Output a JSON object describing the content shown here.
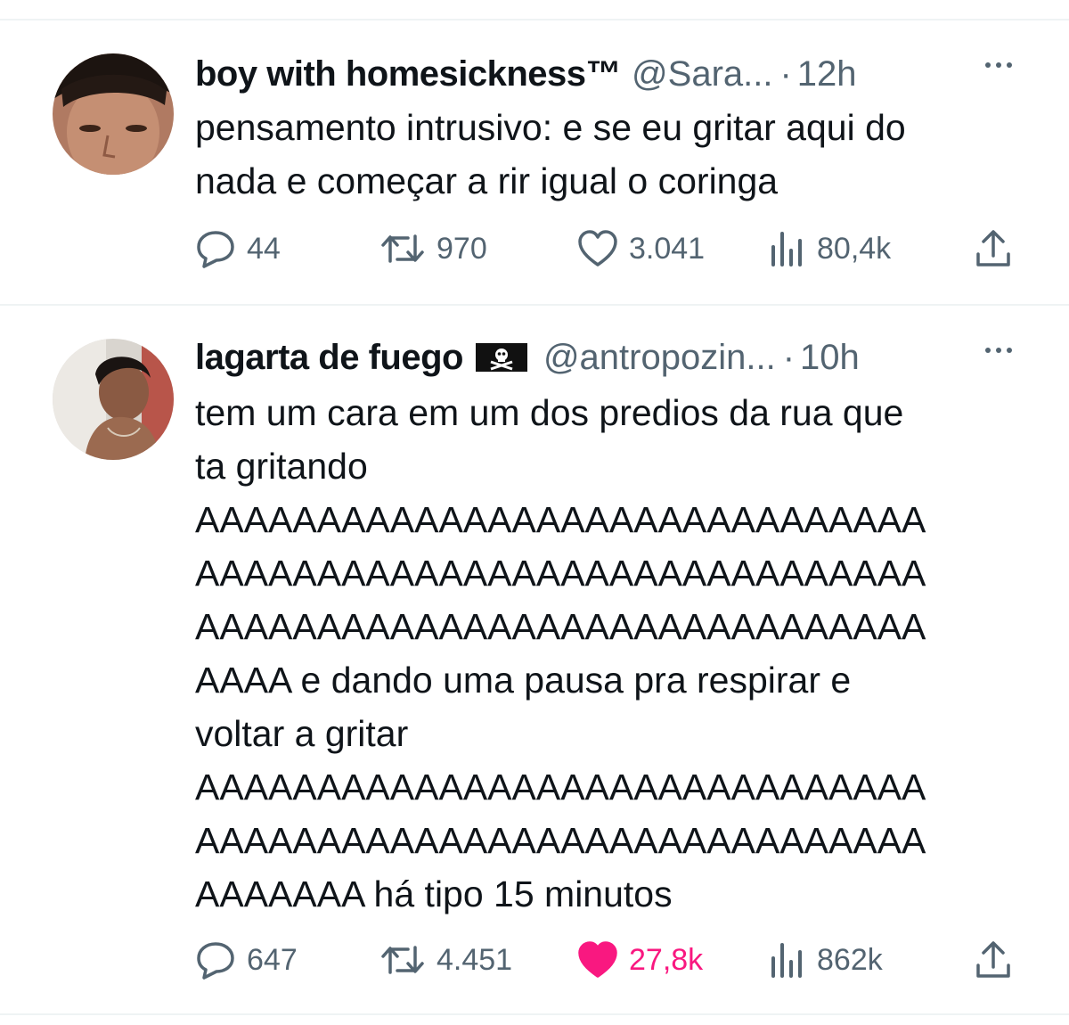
{
  "tweets": [
    {
      "author": {
        "name": "boy with homesickness™",
        "handle": "@Sara...",
        "time": "12h",
        "badge": ""
      },
      "text": [
        "pensamento intrusivo:   e se eu gritar aqui do",
        "nada  e começar a rir igual o coringa"
      ],
      "metrics": {
        "replies": "44",
        "retweets": "970",
        "likes": "3.041",
        "views": "80,4k"
      },
      "liked": false
    },
    {
      "author": {
        "name": "lagarta de fuego",
        "handle": "@antropozin...",
        "time": "10h",
        "badge": "pirate-flag-icon"
      },
      "text": [
        "tem um cara em um dos predios da rua que",
        "ta gritando",
        "AAAAAAAAAAAAAAAAAAAAAAAAAAAAAA",
        "AAAAAAAAAAAAAAAAAAAAAAAAAAAAAA",
        "AAAAAAAAAAAAAAAAAAAAAAAAAAAAAA",
        "AAAA e dando uma pausa pra respirar e",
        "voltar a gritar",
        "AAAAAAAAAAAAAAAAAAAAAAAAAAAAAA",
        "AAAAAAAAAAAAAAAAAAAAAAAAAAAAAA",
        "AAAAAAA há tipo 15 minutos"
      ],
      "metrics": {
        "replies": "647",
        "retweets": "4.451",
        "likes": "27,8k",
        "views": "862k"
      },
      "liked": true
    }
  ],
  "colors": {
    "text": "#0f1419",
    "secondary": "#536471",
    "like_active": "#f91880",
    "divider": "#eff3f4"
  },
  "icons": [
    "reply-icon",
    "retweet-icon",
    "like-icon",
    "views-icon",
    "share-icon",
    "more-icon"
  ]
}
